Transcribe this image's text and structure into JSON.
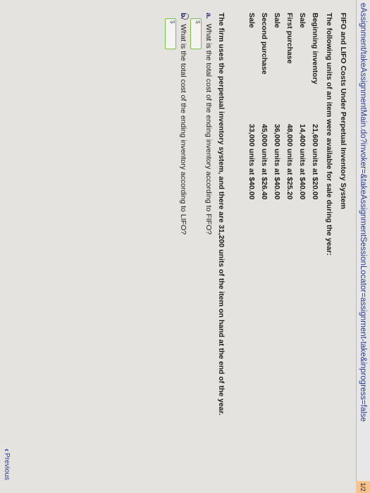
{
  "browser": {
    "url": "eAssignment/takeAssignmentMain.do?invoker=&takeAssignmentSessionLocator=assignment-take&inprogress=false",
    "badge": "1/2"
  },
  "problem": {
    "title": "FIFO and LIFO Costs Under Perpetual Inventory System",
    "intro": "The following units of an item were available for sale during the year:",
    "rows": [
      {
        "label": "Beginning inventory",
        "value": "21,600 units at $20.00"
      },
      {
        "label": "Sale",
        "value": "14,400 units at $40.00"
      },
      {
        "label": "First purchase",
        "value": "48,000 units at $25.20"
      },
      {
        "label": "Sale",
        "value": "36,000 units at $40.00"
      },
      {
        "label": "Second purchase",
        "value": "45,000 units at $26.40"
      },
      {
        "label": "Sale",
        "value": "33,000 units at $40.00"
      }
    ],
    "statement": "The firm uses the perpetual inventory system, and there are 31,200 units of the item on hand at the end of the year.",
    "questions": [
      {
        "letter": "a.",
        "text": "What is the total cost of the ending inventory according to FIFO?",
        "currency": "$",
        "value": ""
      },
      {
        "letter": "b.",
        "text": "What is the total cost of the ending inventory according to LIFO?",
        "currency": "$",
        "value": ""
      }
    ]
  },
  "nav": {
    "previous_label": "Previous"
  },
  "colors": {
    "answer_border": "#7fbd4a",
    "link": "#2a3a8c"
  }
}
